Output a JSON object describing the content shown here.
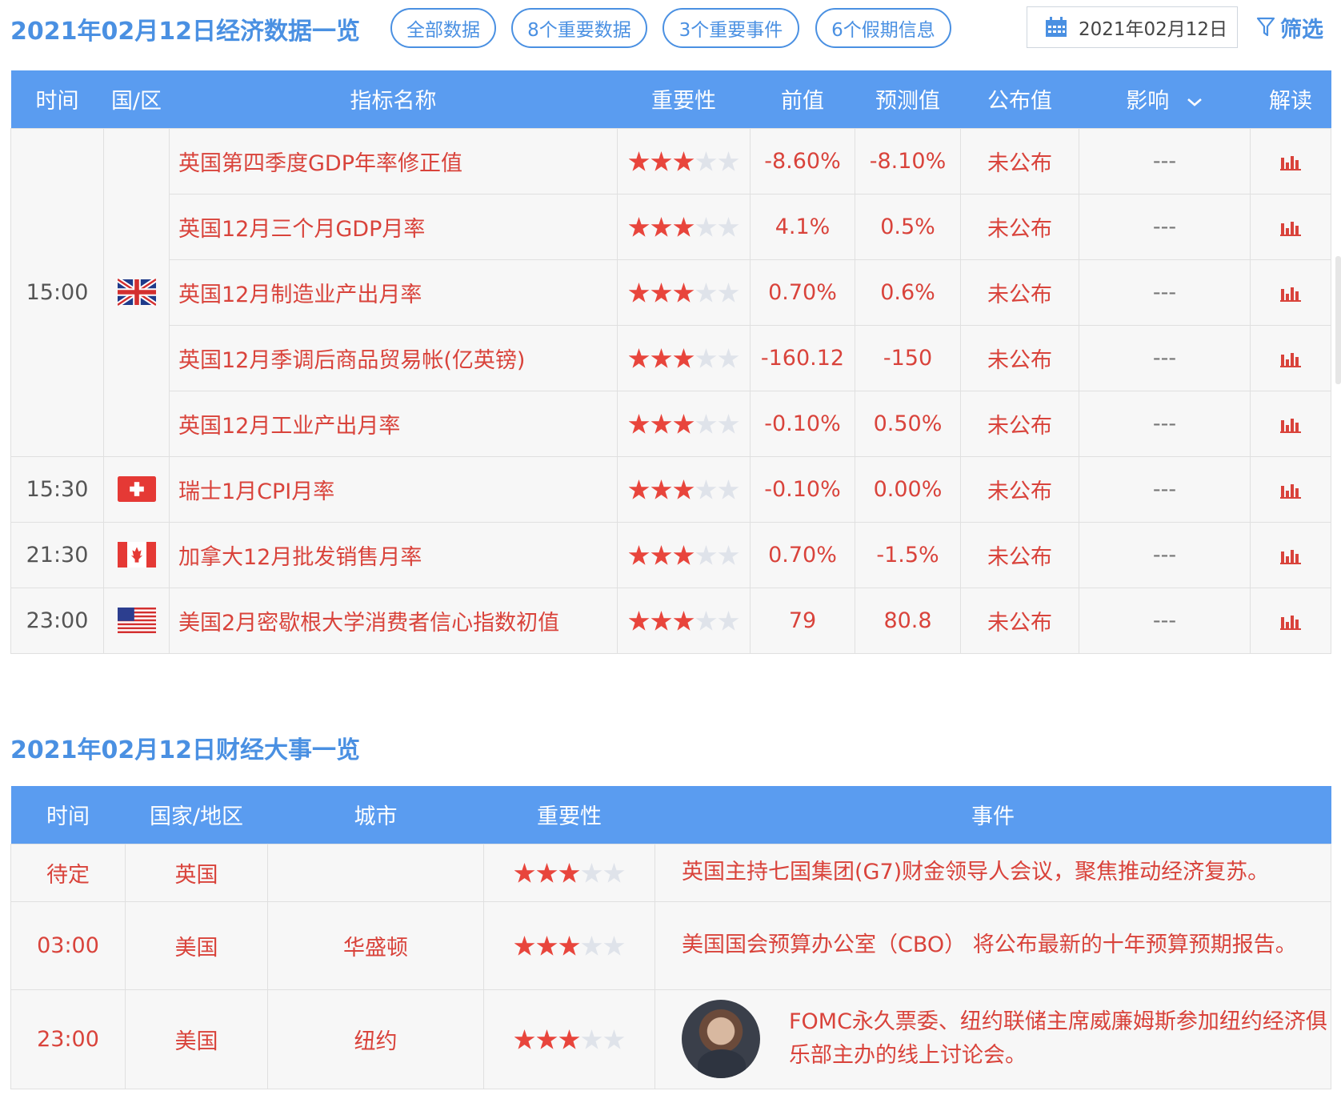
{
  "toolbar": {
    "title": "2021年02月12日经济数据一览",
    "pills": [
      "全部数据",
      "8个重要数据",
      "3个重要事件",
      "6个假期信息"
    ],
    "date": "2021年02月12日",
    "calendar_icon": "calendar-icon",
    "filter_label": "筛选",
    "filter_icon": "filter-icon"
  },
  "data_table": {
    "headers": {
      "time": "时间",
      "country": "国/区",
      "name": "指标名称",
      "importance": "重要性",
      "previous": "前值",
      "forecast": "预测值",
      "actual": "公布值",
      "impact": "影响",
      "analysis": "解读"
    },
    "rows": [
      {
        "time": "15:00",
        "flag": "uk",
        "name": "英国第四季度GDP年率修正值",
        "stars": 3,
        "previous": "-8.60%",
        "forecast": "-8.10%",
        "actual": "未公布",
        "impact": "---"
      },
      {
        "time": "",
        "flag": "",
        "name": "英国12月三个月GDP月率",
        "stars": 3,
        "previous": "4.1%",
        "forecast": "0.5%",
        "actual": "未公布",
        "impact": "---"
      },
      {
        "time": "",
        "flag": "",
        "name": "英国12月制造业产出月率",
        "stars": 3,
        "previous": "0.70%",
        "forecast": "0.6%",
        "actual": "未公布",
        "impact": "---"
      },
      {
        "time": "",
        "flag": "",
        "name": "英国12月季调后商品贸易帐(亿英镑)",
        "stars": 3,
        "previous": "-160.12",
        "forecast": "-150",
        "actual": "未公布",
        "impact": "---"
      },
      {
        "time": "",
        "flag": "",
        "name": "英国12月工业产出月率",
        "stars": 3,
        "previous": "-0.10%",
        "forecast": "0.50%",
        "actual": "未公布",
        "impact": "---"
      },
      {
        "time": "15:30",
        "flag": "ch",
        "name": "瑞士1月CPI月率",
        "stars": 3,
        "previous": "-0.10%",
        "forecast": "0.00%",
        "actual": "未公布",
        "impact": "---"
      },
      {
        "time": "21:30",
        "flag": "ca",
        "name": "加拿大12月批发销售月率",
        "stars": 3,
        "previous": "0.70%",
        "forecast": "-1.5%",
        "actual": "未公布",
        "impact": "---"
      },
      {
        "time": "23:00",
        "flag": "us",
        "name": "美国2月密歇根大学消费者信心指数初值",
        "stars": 3,
        "previous": "79",
        "forecast": "80.8",
        "actual": "未公布",
        "impact": "---"
      }
    ],
    "max_stars": 5
  },
  "events": {
    "title": "2021年02月12日财经大事一览",
    "headers": {
      "time": "时间",
      "country": "国家/地区",
      "city": "城市",
      "importance": "重要性",
      "event": "事件"
    },
    "rows": [
      {
        "time": "待定",
        "country": "英国",
        "city": "",
        "stars": 3,
        "event": "英国主持七国集团(G7)财金领导人会议，聚焦推动经济复苏。"
      },
      {
        "time": "03:00",
        "country": "美国",
        "city": "华盛顿",
        "stars": 3,
        "event": "美国国会预算办公室（CBO） 将公布最新的十年预算预期报告。"
      },
      {
        "time": "23:00",
        "country": "美国",
        "city": "纽约",
        "stars": 3,
        "event": "FOMC永久票委、纽约联储主席威廉姆斯参加纽约经济俱乐部主办的线上讨论会。"
      }
    ]
  },
  "colors": {
    "accent": "#4a90e2",
    "header_bg": "#5a9cf0",
    "value_red": "#d9433b",
    "star_on": "#e8453c",
    "star_off": "#dfe3ea"
  }
}
